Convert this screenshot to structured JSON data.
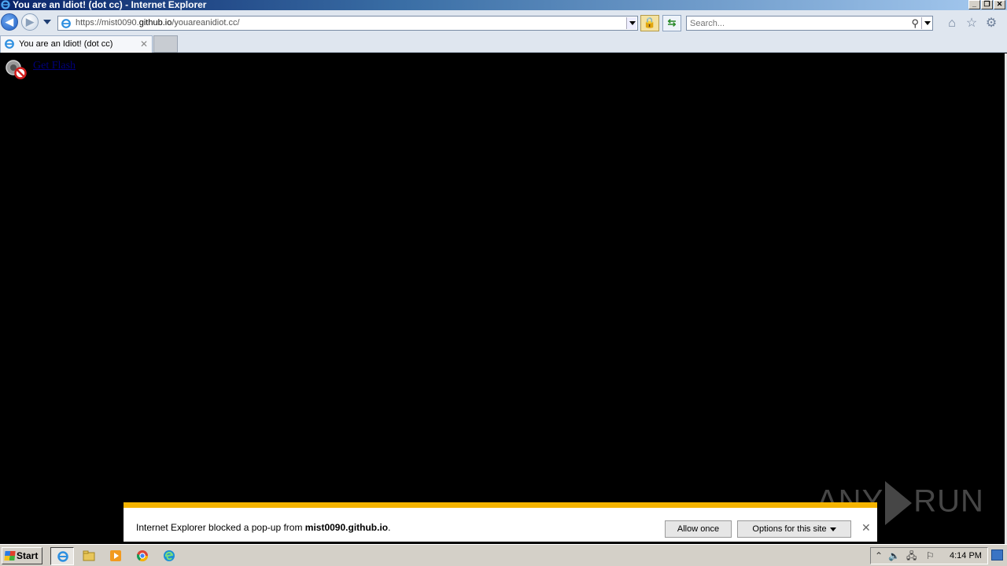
{
  "window": {
    "title": "You are an Idiot! (dot cc) - Internet Explorer",
    "controls": [
      "minimize",
      "restore",
      "close"
    ]
  },
  "navbar": {
    "url_prefix": "https://mist0090.",
    "url_domain": "github.io",
    "url_path": "/youareanidiot.cc/",
    "search_placeholder": "Search..."
  },
  "tabs": [
    {
      "label": "You are an Idiot! (dot cc)",
      "active": true
    }
  ],
  "content": {
    "plugin_link": "Get Flash"
  },
  "notification": {
    "text_prefix": "Internet Explorer blocked a pop-up from ",
    "site": "mist0090.github.io",
    "text_suffix": ".",
    "allow_once": "Allow once",
    "options": "Options for this site"
  },
  "watermark": {
    "left": "ANY",
    "right": "RUN"
  },
  "taskbar": {
    "start": "Start",
    "apps": [
      "internet-explorer-icon",
      "file-explorer-icon",
      "media-player-icon",
      "chrome-icon",
      "edge-icon"
    ],
    "clock": "4:14 PM"
  },
  "colors": {
    "notification_accent": "#f5b400",
    "content_background": "#000000"
  }
}
